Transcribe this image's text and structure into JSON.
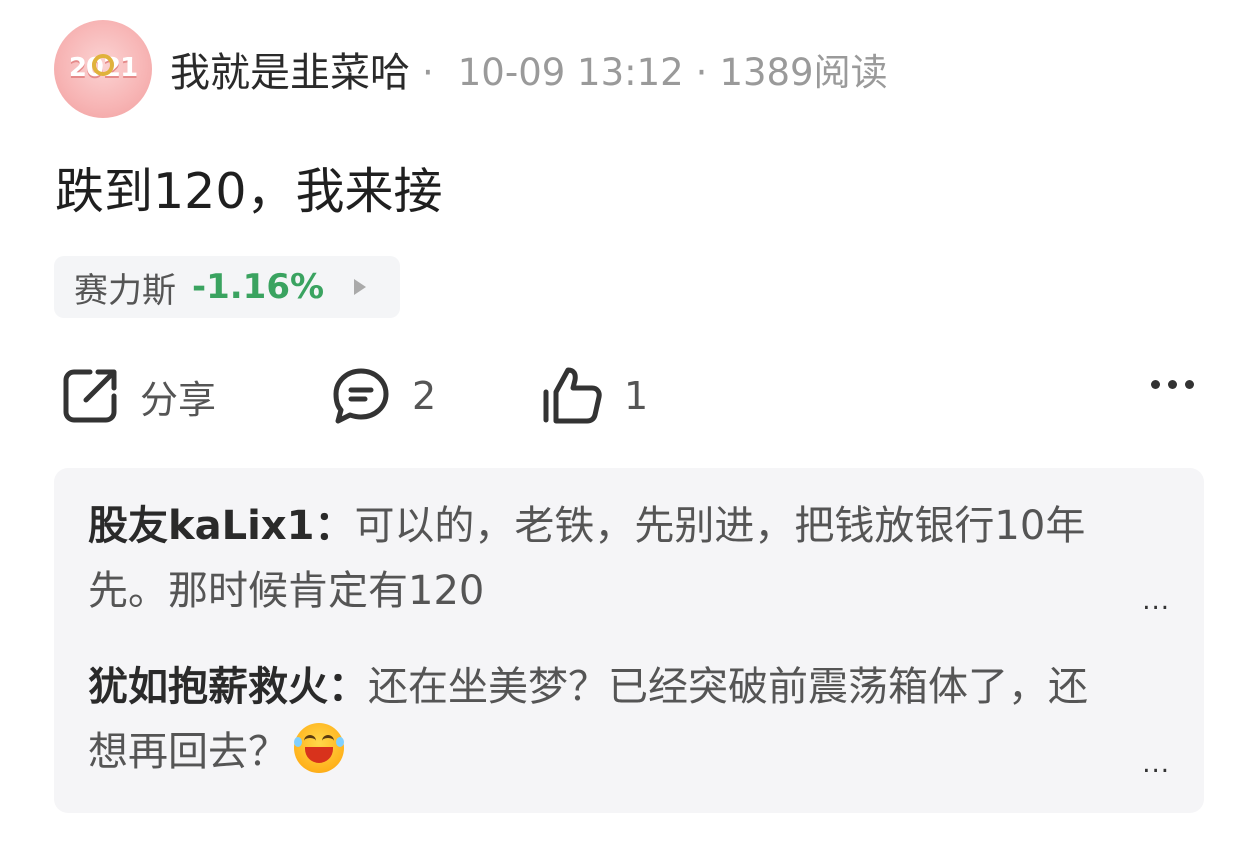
{
  "post": {
    "avatar_text": "2021",
    "author": "我就是韭菜哈",
    "date": "10-09 13:12",
    "reads": "1389阅读",
    "separator": "·",
    "text": "跌到120，我来接"
  },
  "stock": {
    "name": "赛力斯",
    "change": "-1.16%",
    "change_color": "#3aa360"
  },
  "actions": {
    "share_label": "分享",
    "comment_count": "2",
    "like_count": "1",
    "icons": [
      "share-icon",
      "comment-icon",
      "thumbs-up-icon",
      "more-icon"
    ]
  },
  "comments": [
    {
      "user": "股友kaLix1：",
      "text": "可以的，老铁，先别进，把钱放银行10年先。那时候肯定有120",
      "more": "..."
    },
    {
      "user": "犹如抱薪救火：",
      "text": "还在坐美梦？已经突破前震荡箱体了，还想再回去？",
      "emoji": "laughing-emoji",
      "more": "..."
    }
  ]
}
